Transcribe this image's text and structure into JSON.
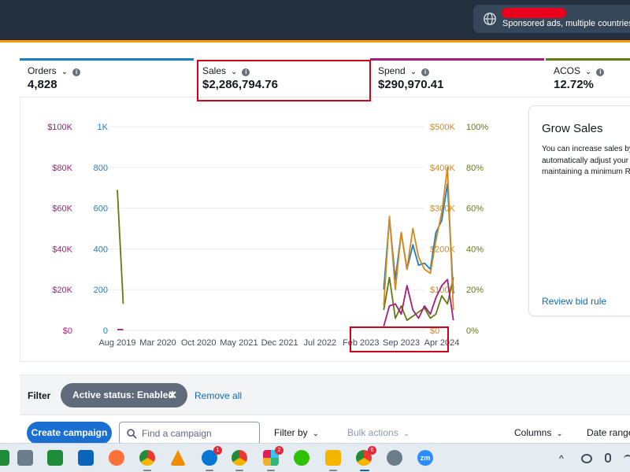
{
  "header": {
    "account_scope": "Sponsored ads, multiple countries",
    "icons": [
      "globe-icon"
    ]
  },
  "metrics": [
    {
      "label": "Orders",
      "value": "4,828",
      "color": "#1b7fc4"
    },
    {
      "label": "Sales",
      "value": "$2,286,794.76",
      "color": "#f29d29"
    },
    {
      "label": "Spend",
      "value": "$290,970.41",
      "color": "#a51e7c"
    },
    {
      "label": "ACOS",
      "value": "12.72%",
      "color": "#627a10"
    }
  ],
  "chart_data": {
    "type": "line",
    "x_tick_labels": [
      "Aug 2019",
      "Mar 2020",
      "Oct 2020",
      "May 2021",
      "Dec 2021",
      "Jul 2022",
      "Feb 2023",
      "Sep 2023",
      "Apr 2024"
    ],
    "axes": [
      {
        "series": "Spend",
        "side": "left",
        "ticks": [
          "$100K",
          "$80K",
          "$60K",
          "$40K",
          "$20K",
          "$0"
        ],
        "range": [
          0,
          100000
        ],
        "color": "#a51e7c"
      },
      {
        "series": "Orders",
        "side": "left",
        "ticks": [
          "1K",
          "800",
          "600",
          "400",
          "200",
          "0"
        ],
        "range": [
          0,
          1000
        ],
        "color": "#1b7fc4"
      },
      {
        "series": "Sales",
        "side": "right",
        "ticks": [
          "$500K",
          "$400K",
          "$300K",
          "$200K",
          "$100K",
          "$0"
        ],
        "range": [
          0,
          500000
        ],
        "color": "#d98817"
      },
      {
        "series": "ACOS",
        "side": "right",
        "ticks": [
          "100%",
          "80%",
          "60%",
          "40%",
          "20%",
          "0%"
        ],
        "range": [
          0,
          100
        ],
        "color": "#627a10"
      }
    ],
    "grid": true,
    "series": [
      {
        "name": "ACOS",
        "color": "#627a10",
        "x": [
          "Aug 2019",
          "Sep 2019"
        ],
        "y": [
          69,
          13
        ]
      },
      {
        "name": "Spend",
        "color": "#a51e7c",
        "x": [
          "Aug 2019",
          "Sep 2019"
        ],
        "y": [
          400,
          400
        ]
      },
      {
        "name": "ACOS",
        "color": "#627a10",
        "x": [
          "Jun 2023",
          "Jul 2023",
          "Aug 2023",
          "Sep 2023",
          "Oct 2023",
          "Nov 2023",
          "Dec 2023",
          "Jan 2024",
          "Feb 2024",
          "Mar 2024",
          "Apr 2024",
          "May 2024",
          "Jun 2024"
        ],
        "y": [
          10,
          26,
          6,
          12,
          5,
          7,
          9,
          11,
          6,
          8,
          17,
          13,
          26
        ]
      },
      {
        "name": "Orders",
        "color": "#1b7fc4",
        "x": [
          "Jun 2023",
          "Jul 2023",
          "Aug 2023",
          "Sep 2023",
          "Oct 2023",
          "Nov 2023",
          "Dec 2023",
          "Jan 2024",
          "Feb 2024",
          "Mar 2024",
          "Apr 2024",
          "May 2024",
          "Jun 2024"
        ],
        "y": [
          200,
          550,
          250,
          480,
          300,
          420,
          320,
          330,
          300,
          480,
          540,
          720,
          180
        ]
      },
      {
        "name": "Sales",
        "color": "#d98817",
        "x": [
          "Jun 2023",
          "Jul 2023",
          "Aug 2023",
          "Sep 2023",
          "Oct 2023",
          "Nov 2023",
          "Dec 2023",
          "Jan 2024",
          "Feb 2024",
          "Mar 2024",
          "Apr 2024",
          "May 2024",
          "Jun 2024"
        ],
        "y": [
          60000,
          280000,
          100000,
          240000,
          150000,
          250000,
          180000,
          150000,
          140000,
          220000,
          290000,
          400000,
          50000
        ]
      },
      {
        "name": "Spend",
        "color": "#a51e7c",
        "x": [
          "Jun 2023",
          "Jul 2023",
          "Aug 2023",
          "Sep 2023",
          "Oct 2023",
          "Nov 2023",
          "Dec 2023",
          "Jan 2024",
          "Feb 2024",
          "Mar 2024",
          "Apr 2024",
          "May 2024",
          "Jun 2024"
        ],
        "y": [
          2000,
          12000,
          13000,
          8000,
          22000,
          10000,
          6000,
          12000,
          8000,
          16000,
          22000,
          25000,
          5000
        ]
      }
    ]
  },
  "grow_sales": {
    "title": "Grow Sales",
    "body_lines": [
      "You can increase sales by",
      "automatically adjust your",
      "maintaining a minimum R"
    ],
    "link": "Review bid rule"
  },
  "filter": {
    "label": "Filter",
    "chip": "Active status: Enabled",
    "chip_close": "✕",
    "remove_all": "Remove all"
  },
  "toolbar": {
    "create_campaign": "Create campaign",
    "search_placeholder": "Find a campaign",
    "filter_by": "Filter by",
    "bulk_actions": "Bulk actions",
    "columns": "Columns",
    "date_range": "Date range",
    "chevron": "⌄"
  },
  "taskbar": {
    "badges": {
      "skype": "1",
      "slack": "2",
      "chrome2": "6"
    },
    "zoom_label": "zm",
    "tray_caret": "^",
    "accent_colors": [
      "#1e8c39",
      "#2b579a",
      "#ff7139",
      "#e83a31",
      "#0078d4",
      "#f4b400"
    ]
  }
}
